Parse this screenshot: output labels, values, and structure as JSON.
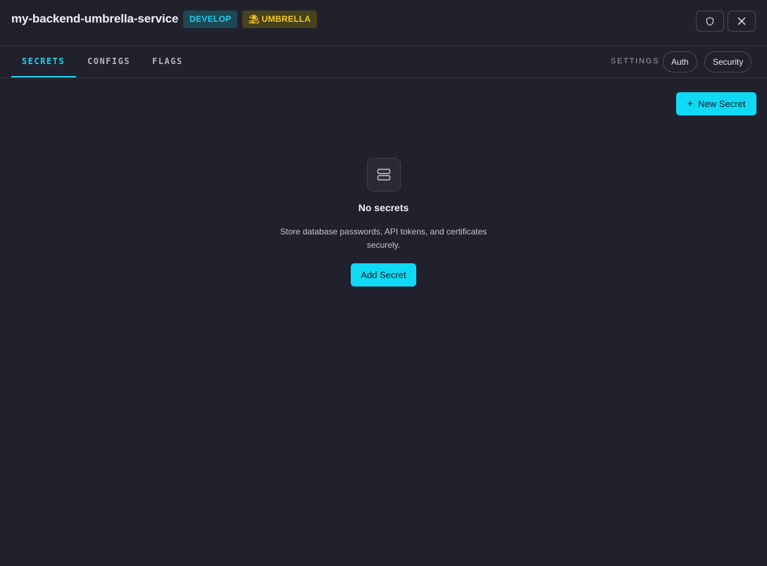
{
  "header": {
    "title": "my-backend-umbrella-service",
    "env_badge": "DEVELOP",
    "type_badge": "UMBRELLA",
    "type_badge_icon": "umbrella-icon",
    "shield_icon": "shield-icon",
    "close_icon": "close-icon"
  },
  "tabs": [
    {
      "label": "SECRETS",
      "active": true
    },
    {
      "label": "CONFIGS",
      "active": false
    },
    {
      "label": "FLAGS",
      "active": false
    }
  ],
  "settings": {
    "label": "SETTINGS",
    "auth": "Auth",
    "security": "Security"
  },
  "actions": {
    "new_secret_icon": "+",
    "new_secret": "New Secret"
  },
  "empty_state": {
    "icon": "server-icon",
    "title": "No secrets",
    "description": "Store database passwords, API tokens, and certificates securely.",
    "button": "Add Secret"
  },
  "colors": {
    "background": "#21212d",
    "accent": "#0fd9f5",
    "env_badge_text": "#22cdea",
    "type_badge_text": "#f5cc1f"
  }
}
